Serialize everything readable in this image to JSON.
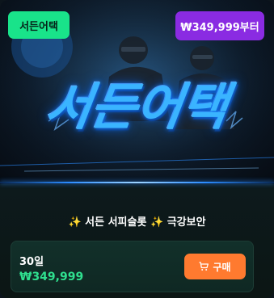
{
  "card": {
    "category_tag": "서든어택",
    "price_tag": "₩349,999부터",
    "banner_title": "서든어택",
    "product_title_spark_left": "✨",
    "product_title_text": "서든 서피슬롯",
    "product_title_spark_mid": "✨",
    "product_title_suffix": "극강보안",
    "plan": {
      "duration": "30일",
      "price": "₩349,999",
      "buy_label": "구매"
    }
  },
  "colors": {
    "category_tag_bg": "#19e38a",
    "price_tag_bg": "#8a2be2",
    "price_text": "#2fe08f",
    "buy_button_bg": "#ff7a2f",
    "banner_title": "#3ab4ff"
  },
  "icons": {
    "buy": "cart-icon"
  }
}
